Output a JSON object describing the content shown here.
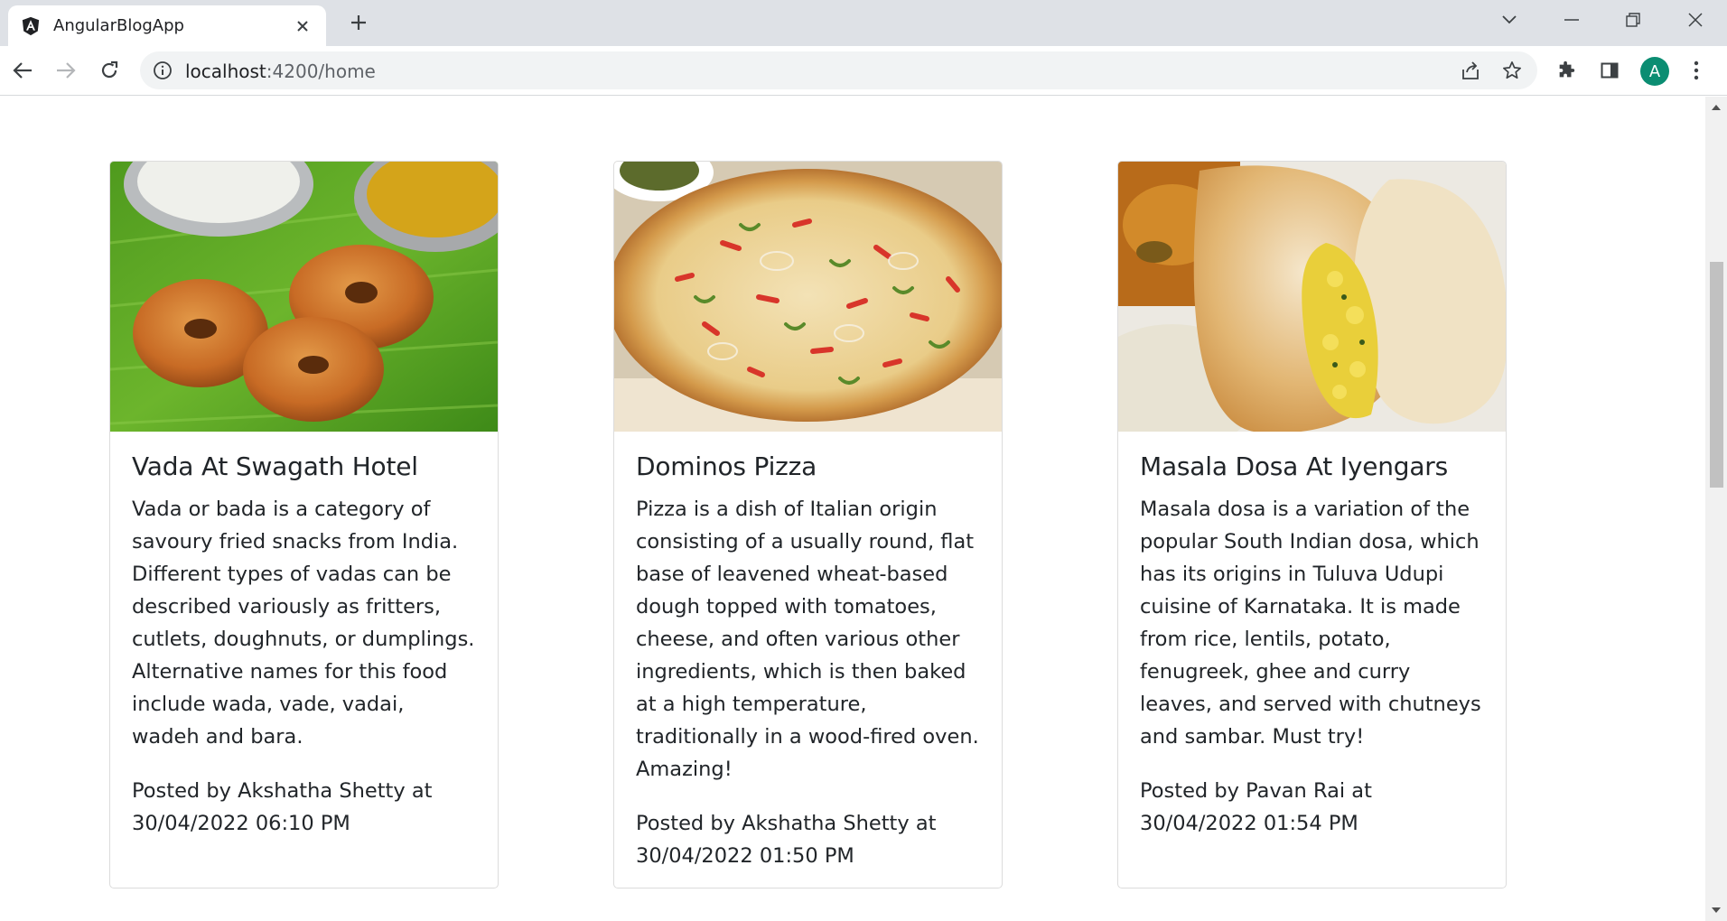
{
  "browser": {
    "tab_title": "AngularBlogApp",
    "url_host": "localhost",
    "url_path": ":4200/home",
    "avatar_letter": "A"
  },
  "posts": [
    {
      "title": "Vada At Swagath Hotel",
      "body": "Vada or bada is a category of savoury fried snacks from India. Different types of vadas can be described variously as fritters, cutlets, doughnuts, or dumplings. Alternative names for this food include wada, vade, vadai, wadeh and bara.",
      "meta": "Posted by Akshatha Shetty at 30/04/2022 06:10 PM",
      "image": "vada-photo"
    },
    {
      "title": "Dominos Pizza",
      "body": "Pizza is a dish of Italian origin consisting of a usually round, flat base of leavened wheat-based dough topped with tomatoes, cheese, and often various other ingredients, which is then baked at a high temperature, traditionally in a wood-fired oven. Amazing!",
      "meta": "Posted by Akshatha Shetty at 30/04/2022 01:50 PM",
      "image": "pizza-photo"
    },
    {
      "title": "Masala Dosa At Iyengars",
      "body": "Masala dosa is a variation of the popular South Indian dosa, which has its origins in Tuluva Udupi cuisine of Karnataka. It is made from rice, lentils, potato, fenugreek, ghee and curry leaves, and served with chutneys and sambar. Must try!",
      "meta": "Posted by Pavan Rai at 30/04/2022 01:54 PM",
      "image": "dosa-photo"
    }
  ]
}
